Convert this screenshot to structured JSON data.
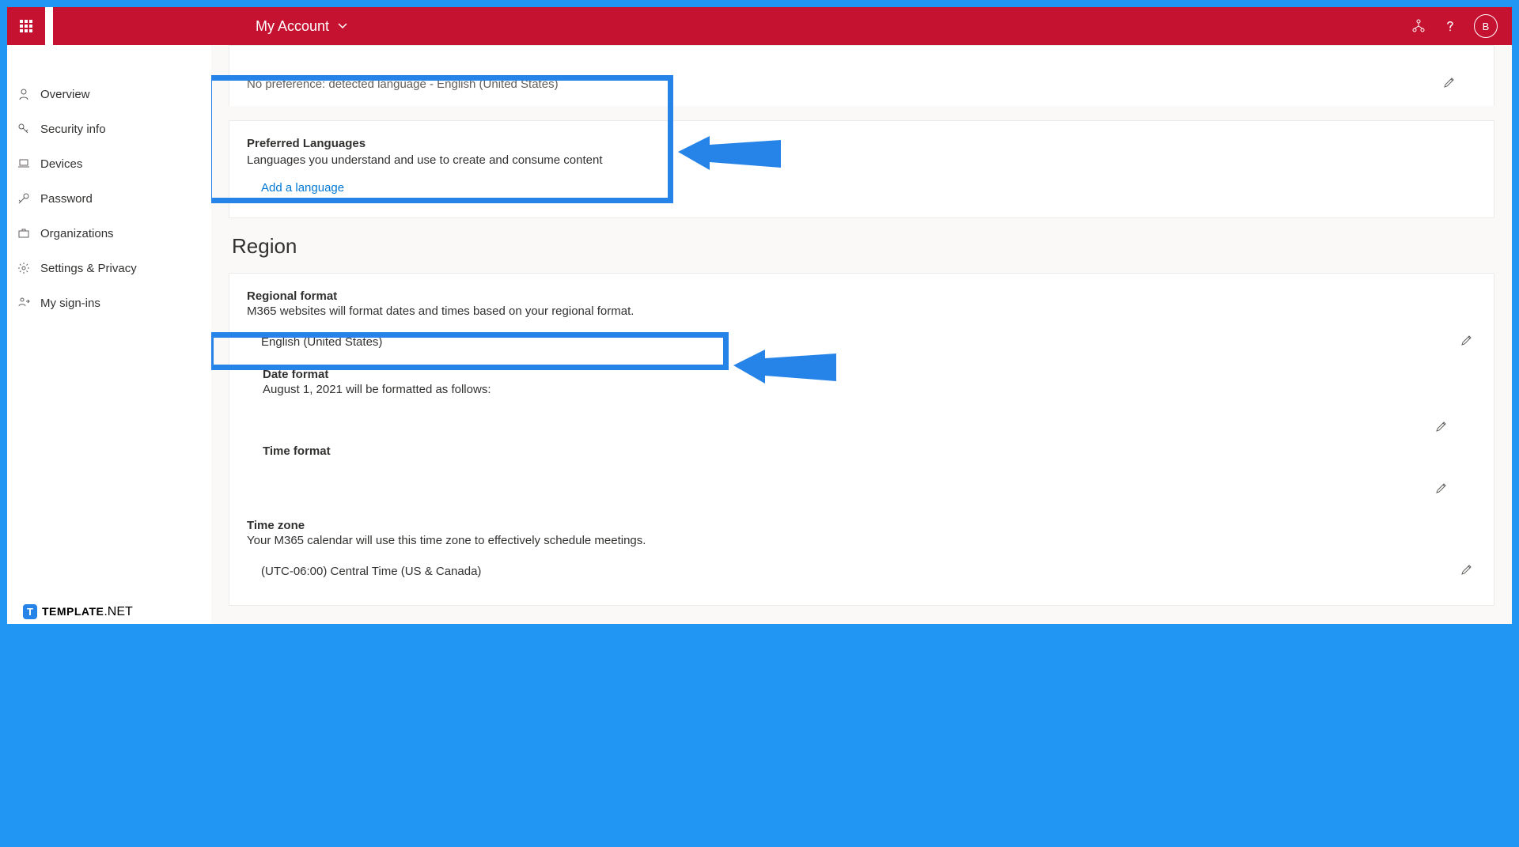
{
  "header": {
    "title": "My Account",
    "avatar_initial": "B"
  },
  "sidebar": {
    "items": [
      {
        "label": "Overview",
        "icon": "person"
      },
      {
        "label": "Security info",
        "icon": "key"
      },
      {
        "label": "Devices",
        "icon": "laptop"
      },
      {
        "label": "Password",
        "icon": "keylock"
      },
      {
        "label": "Organizations",
        "icon": "briefcase"
      },
      {
        "label": "Settings & Privacy",
        "icon": "gear"
      },
      {
        "label": "My sign-ins",
        "icon": "signin"
      }
    ]
  },
  "content": {
    "detected_text": "No preference: detected language - English (United States)",
    "pref_lang_title": "Preferred Languages",
    "pref_lang_desc": "Languages you understand and use to create and consume content",
    "add_lang_link": "Add a language",
    "region_header": "Region",
    "regional_format_title": "Regional format",
    "regional_format_desc": "M365 websites will format dates and times based on your regional format.",
    "regional_format_value": "English (United States)",
    "date_format_title": "Date format",
    "date_format_desc": "August 1, 2021 will be formatted as follows:",
    "time_format_title": "Time format",
    "timezone_title": "Time zone",
    "timezone_desc": "Your M365 calendar will use this time zone to effectively schedule meetings.",
    "timezone_value": "(UTC-06:00) Central Time (US & Canada)"
  },
  "watermark": {
    "badge": "T",
    "brand": "TEMPLATE",
    "suffix": ".NET"
  }
}
